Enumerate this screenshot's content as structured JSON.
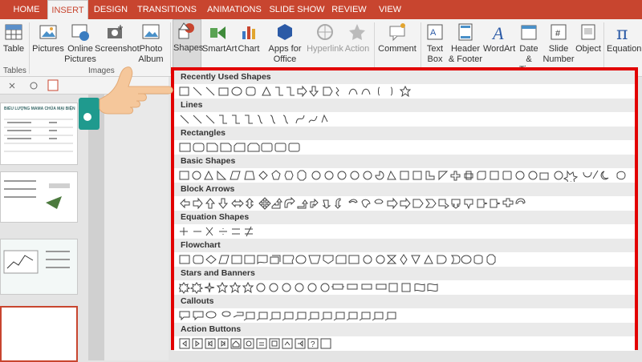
{
  "tabs": [
    "HOME",
    "INSERT",
    "DESIGN",
    "TRANSITIONS",
    "ANIMATIONS",
    "SLIDE SHOW",
    "REVIEW",
    "VIEW"
  ],
  "active_tab": "INSERT",
  "ribbon": {
    "table": "Table",
    "pictures": "Pictures",
    "online_pictures": "Online Pictures",
    "screenshot": "Screenshot",
    "photo_album": "Photo Album",
    "shapes": "Shapes",
    "smartart": "SmartArt",
    "chart": "Chart",
    "apps_for_office": "Apps for Office",
    "hyperlink": "Hyperlink",
    "action": "Action",
    "comment": "Comment",
    "text_box": "Text Box",
    "header_footer": "Header & Footer",
    "wordart": "WordArt",
    "date_time": "Date & Time",
    "slide_number": "Slide Number",
    "object": "Object",
    "equation": "Equation",
    "group_tables": "Tables",
    "group_images": "Images"
  },
  "gallery": {
    "categories": [
      "Recently Used Shapes",
      "Lines",
      "Rectangles",
      "Basic Shapes",
      "Block Arrows",
      "Equation Shapes",
      "Flowchart",
      "Stars and Banners",
      "Callouts",
      "Action Buttons"
    ]
  },
  "thumbs": {
    "t1_title": "BIỂU LƯỢNG MAMA CHÚA MẠI BIỆN"
  },
  "colors": {
    "accent": "#c8452f",
    "highlight": "#e20000"
  }
}
